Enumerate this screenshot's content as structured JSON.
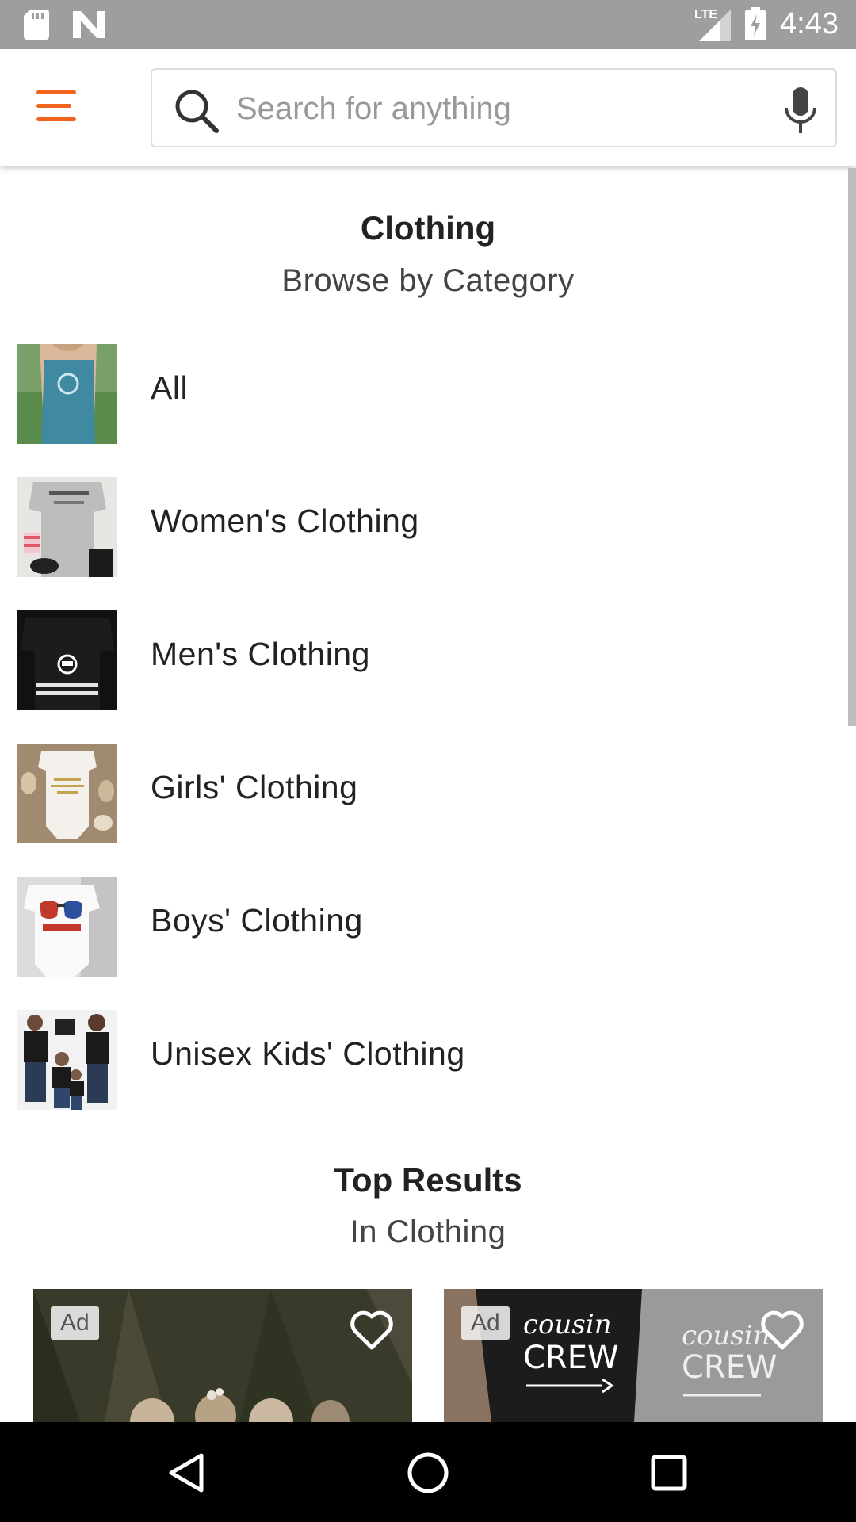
{
  "status_bar": {
    "time": "4:43",
    "network": "LTE",
    "icons": [
      "sd-card-icon",
      "n-notification-icon",
      "signal-icon",
      "battery-charging-icon"
    ]
  },
  "app_bar": {
    "menu_icon": "hamburger-menu-icon",
    "search_placeholder": "Search for anything",
    "search_icon": "search-icon",
    "mic_icon": "microphone-icon"
  },
  "category_section": {
    "title": "Clothing",
    "subtitle": "Browse by Category",
    "items": [
      {
        "label": "All"
      },
      {
        "label": "Women's Clothing"
      },
      {
        "label": "Men's Clothing"
      },
      {
        "label": "Girls' Clothing"
      },
      {
        "label": "Boys' Clothing"
      },
      {
        "label": "Unisex Kids' Clothing"
      }
    ]
  },
  "results_section": {
    "title": "Top Results",
    "subtitle": "In Clothing",
    "cards": [
      {
        "badge": "Ad",
        "favorite_icon": "heart-outline-icon"
      },
      {
        "badge": "Ad",
        "favorite_icon": "heart-outline-icon"
      }
    ]
  },
  "nav_bar": {
    "icons": [
      "back-triangle-icon",
      "home-circle-icon",
      "recents-square-icon"
    ]
  },
  "colors": {
    "accent": "#f1641e",
    "status_bar": "#9e9e9e",
    "nav_bar": "#000000"
  }
}
